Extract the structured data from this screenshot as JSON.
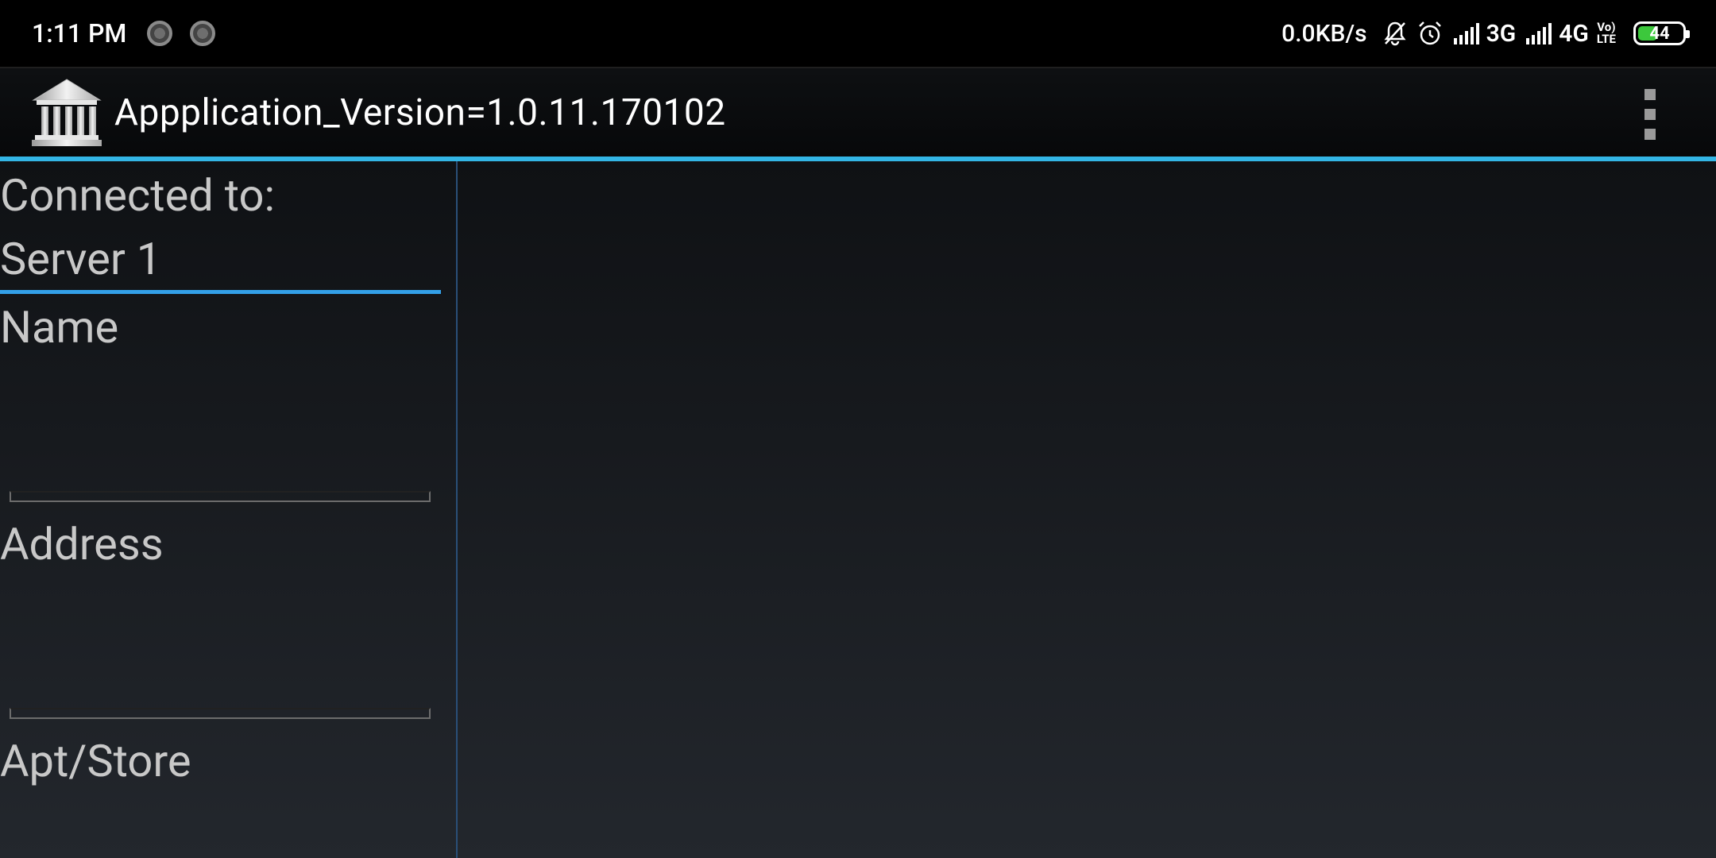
{
  "status_bar": {
    "time": "1:11 PM",
    "net_speed": "0.0KB/s",
    "network_1": "3G",
    "network_2": "4G",
    "volte_top": "Vo)",
    "volte_bottom": "LTE",
    "battery_level": "44",
    "battery_fraction": 0.44,
    "icons": [
      "spinner-icon",
      "spinner-icon",
      "bell-muted-icon",
      "alarm-icon",
      "signal-icon",
      "signal-icon",
      "volte-icon",
      "battery-icon"
    ]
  },
  "action_bar": {
    "title": "Appplication_Version=1.0.11.170102",
    "icon": "bank-building-icon",
    "menu_icon": "overflow-menu-icon"
  },
  "left_pane": {
    "connected_label": "Connected to:",
    "server_name": "Server 1",
    "fields": [
      {
        "label": "Name",
        "value": ""
      },
      {
        "label": "Address",
        "value": ""
      },
      {
        "label": "Apt/Store",
        "value": ""
      }
    ]
  },
  "colors": {
    "accent_blue": "#33b5e5",
    "underline_blue": "#33a0e8",
    "pane_divider": "#2a4f78",
    "label_gray": "#c8c8c8"
  }
}
